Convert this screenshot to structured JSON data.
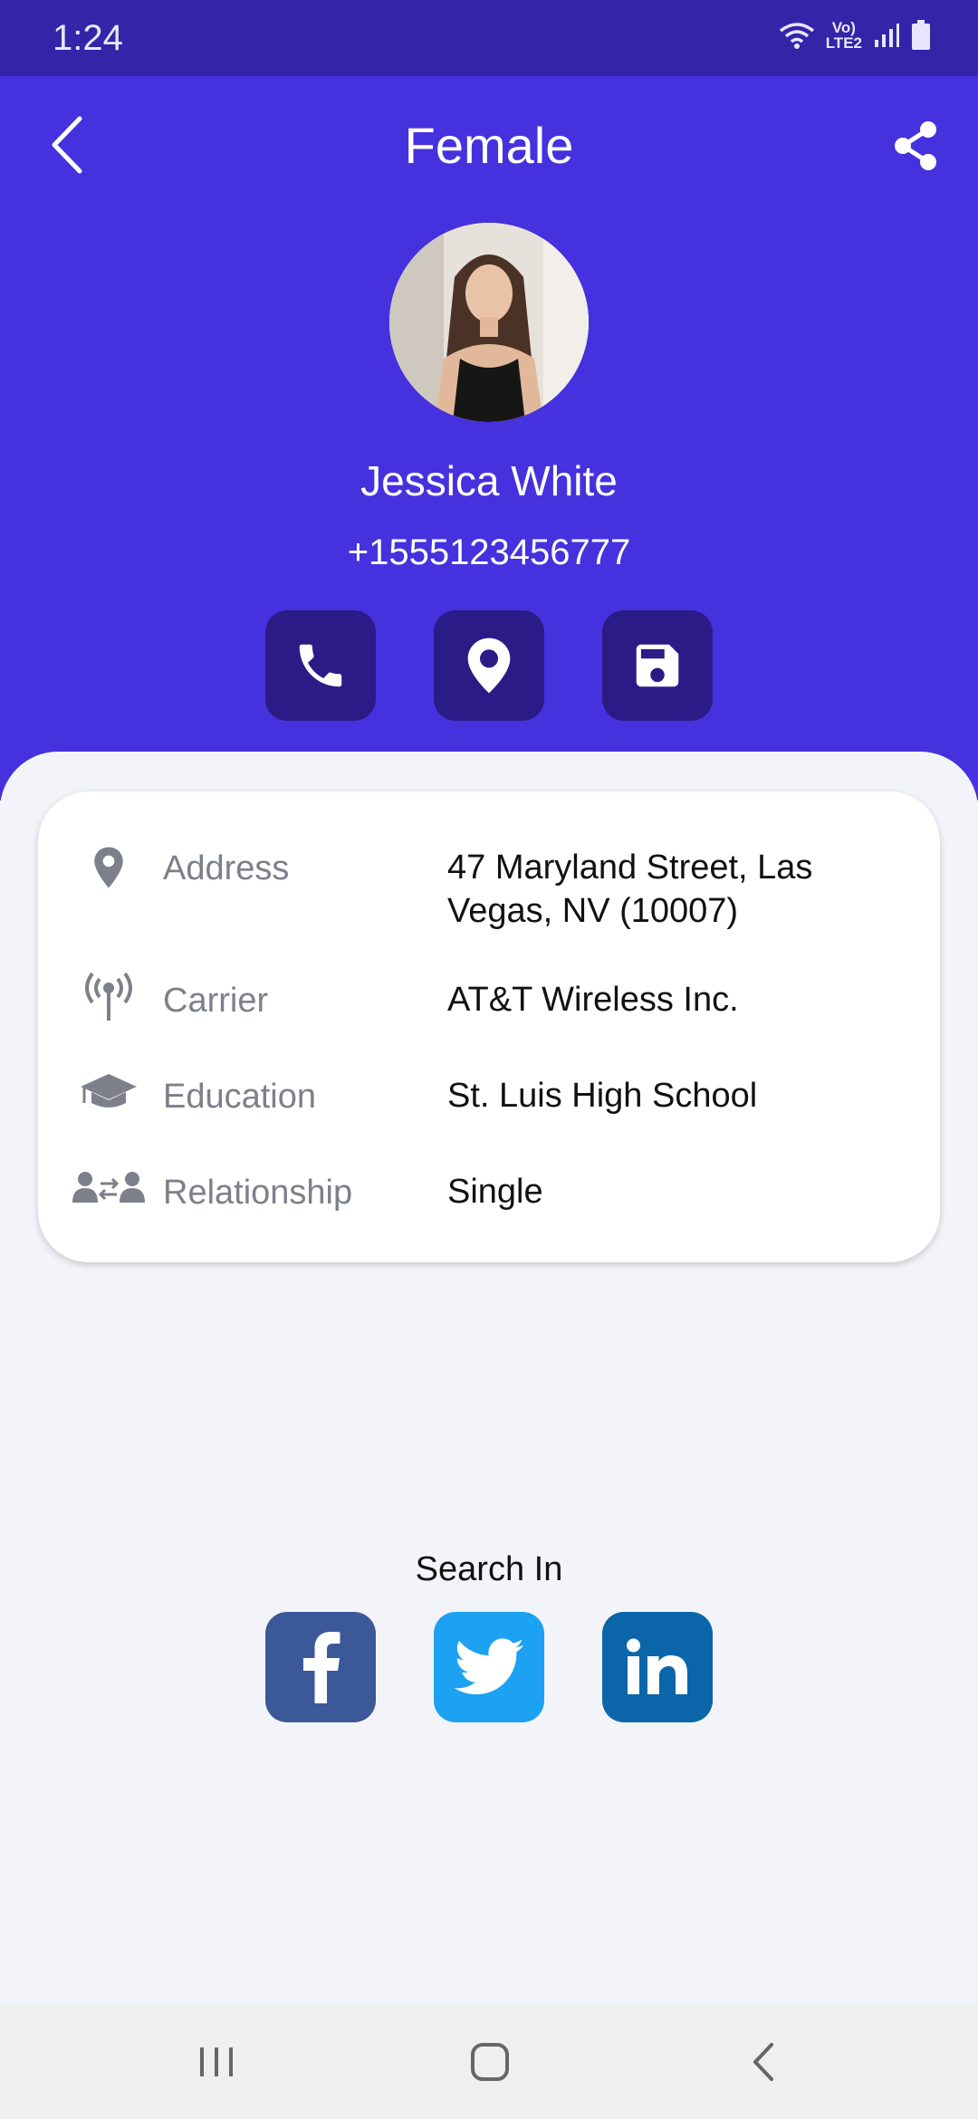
{
  "status_bar": {
    "time": "1:24",
    "network_line1": "Vo)",
    "network_line2": "LTE2"
  },
  "header": {
    "title": "Female"
  },
  "profile": {
    "name": "Jessica White",
    "phone": "+1555123456777"
  },
  "actions": [
    {
      "icon": "phone-icon"
    },
    {
      "icon": "location-pin-icon"
    },
    {
      "icon": "save-icon"
    }
  ],
  "details": {
    "address": {
      "label": "Address",
      "value": "47 Maryland Street, Las Vegas, NV (10007)",
      "icon": "location-pin-icon"
    },
    "carrier": {
      "label": "Carrier",
      "value": "AT&T Wireless Inc.",
      "icon": "antenna-icon"
    },
    "education": {
      "label": "Education",
      "value": "St. Luis High School",
      "icon": "graduation-cap-icon"
    },
    "relationship": {
      "label": "Relationship",
      "value": "Single",
      "icon": "relationship-icon"
    }
  },
  "search": {
    "title": "Search In",
    "networks": [
      {
        "name": "facebook",
        "color": "#3b5998"
      },
      {
        "name": "twitter",
        "color": "#1da1f2"
      },
      {
        "name": "linkedin",
        "color": "#0a66a8"
      }
    ]
  },
  "colors": {
    "header": "#4631de",
    "status_bar": "#3424a8",
    "action_button": "#2b1b86",
    "background": "#f3f4f9"
  }
}
